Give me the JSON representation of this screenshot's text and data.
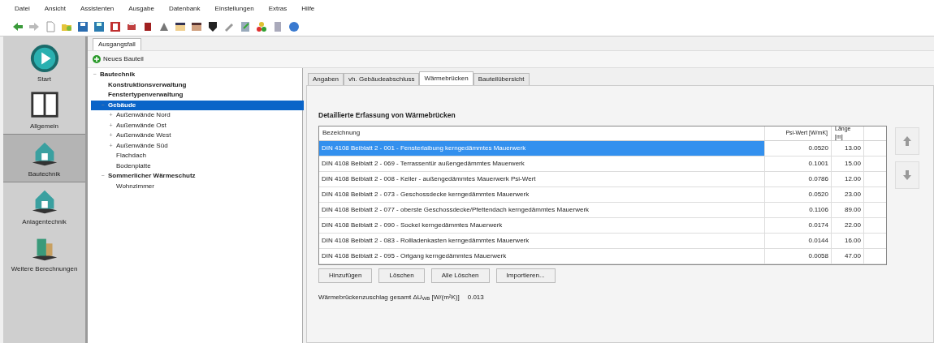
{
  "menu": [
    "Datei",
    "Ansicht",
    "Assistenten",
    "Ausgabe",
    "Datenbank",
    "Einstellungen",
    "Extras",
    "Hilfe"
  ],
  "doc_tabs": [
    {
      "label": "Ausgangsfall",
      "selected": true
    }
  ],
  "new_button": "Neues Bauteil",
  "sidebar": [
    {
      "label": "Start",
      "selected": false
    },
    {
      "label": "Allgemein",
      "selected": false
    },
    {
      "label": "Bautechnik",
      "selected": true
    },
    {
      "label": "Anlagentechnik",
      "selected": false
    },
    {
      "label": "Weitere Berechnungen",
      "selected": false
    }
  ],
  "tree": [
    {
      "expander": "−",
      "label": "Bautechnik",
      "bold": true,
      "selected": false,
      "children": [
        {
          "label": "Konstruktionsverwaltung",
          "bold": true,
          "selected": false
        },
        {
          "label": "Fenstertypenverwaltung",
          "bold": true,
          "selected": false
        },
        {
          "expander": "−",
          "label": "Gebäude",
          "bold": true,
          "selected": true,
          "children": [
            {
              "expander": "+",
              "label": "Außenwände Nord",
              "bold": false,
              "selected": false
            },
            {
              "expander": "+",
              "label": "Außenwände Ost",
              "bold": false,
              "selected": false
            },
            {
              "expander": "+",
              "label": "Außenwände West",
              "bold": false,
              "selected": false
            },
            {
              "expander": "+",
              "label": "Außenwände Süd",
              "bold": false,
              "selected": false
            },
            {
              "label": "Flachdach",
              "bold": false,
              "selected": false
            },
            {
              "label": "Bodenplatte",
              "bold": false,
              "selected": false
            }
          ]
        },
        {
          "expander": "−",
          "label": "Sommerlicher Wärmeschutz",
          "bold": true,
          "selected": false,
          "children": [
            {
              "label": "Wohnzimmer",
              "bold": false,
              "selected": false
            }
          ]
        }
      ]
    }
  ],
  "tabs": [
    {
      "label": "Angaben",
      "selected": false
    },
    {
      "label": "vh. Gebäudeabschluss",
      "selected": false
    },
    {
      "label": "Wärmebrücken",
      "selected": true
    },
    {
      "label": "Bauteilübersicht",
      "selected": false
    }
  ],
  "heading": "Detaillierte Erfassung von Wärmebrücken",
  "table": {
    "columns": [
      "Bezeichnung",
      "Psi-Wert [W/mK]",
      "Länge [m]"
    ],
    "rows": [
      {
        "cells": [
          "DIN 4108 Beiblatt 2 - 001 - Fensterlaibung kerngedämmtes Mauerwerk",
          "0.0520",
          "13.00"
        ],
        "selected": true
      },
      {
        "cells": [
          "DIN 4108 Beiblatt 2 - 069 - Terrassentür außengedämmtes Mauerwerk",
          "0.1001",
          "15.00"
        ],
        "selected": false
      },
      {
        "cells": [
          "DIN 4108 Beiblatt 2 - 008 - Keller - außengedämmtes Mauerwerk Psi-Wert",
          "0.0786",
          "12.00"
        ],
        "selected": false
      },
      {
        "cells": [
          "DIN 4108 Beiblatt 2 - 073 - Geschossdecke kerngedämmtes Mauerwerk",
          "0.0520",
          "23.00"
        ],
        "selected": false
      },
      {
        "cells": [
          "DIN 4108 Beiblatt 2 - 077 - oberste Geschossdecke/Pfettendach kerngedämmtes Mauerwerk",
          "0.1106",
          "89.00"
        ],
        "selected": false
      },
      {
        "cells": [
          "DIN 4108 Beiblatt 2 - 090 - Sockel kerngedämmtes Mauerwerk",
          "0.0174",
          "22.00"
        ],
        "selected": false
      },
      {
        "cells": [
          "DIN 4108 Beiblatt 2 - 083 - Rollladenkasten kerngedämmtes Mauerwerk",
          "0.0144",
          "16.00"
        ],
        "selected": false
      },
      {
        "cells": [
          "DIN 4108 Beiblatt 2 - 095 - Ortgang kerngedämmtes Mauerwerk",
          "0.0058",
          "47.00"
        ],
        "selected": false
      }
    ]
  },
  "buttons": [
    "Hinzufügen",
    "Löschen",
    "Alle Löschen",
    "Importieren..."
  ],
  "total_label": "Wärmebrückenzuschlag gesamt ΔU$_{WB}$ [W/(m²K)]",
  "total_value": "0.013"
}
